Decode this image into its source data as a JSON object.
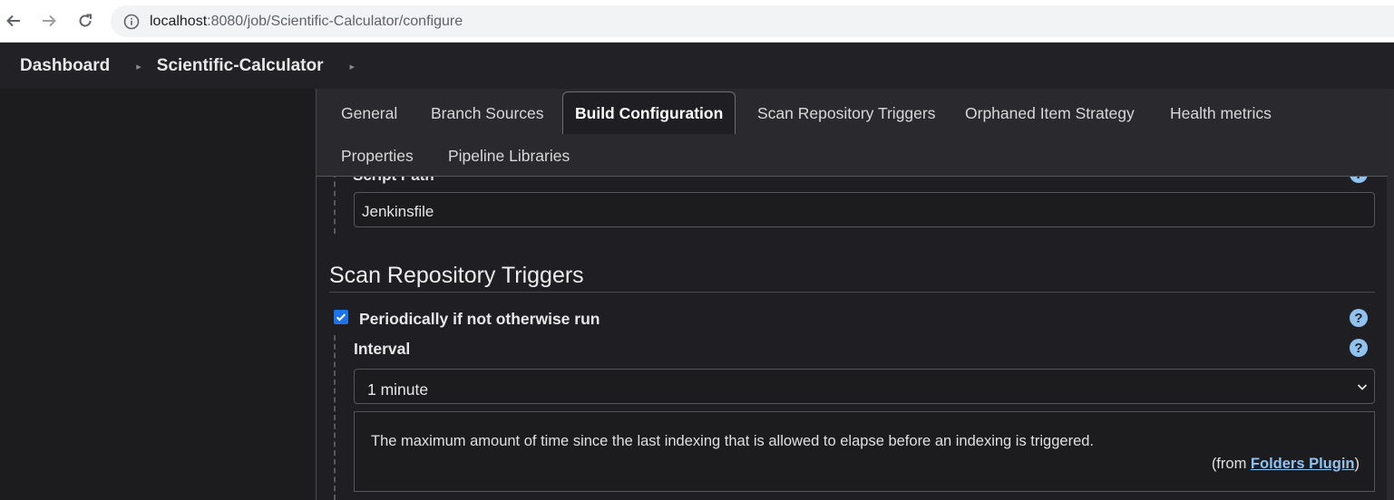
{
  "browser": {
    "url_host": "localhost",
    "url_rest": ":8080/job/Scientific-Calculator/configure"
  },
  "breadcrumb": {
    "items": [
      "Dashboard",
      "Scientific-Calculator"
    ]
  },
  "tabs": [
    {
      "label": "General",
      "active": false
    },
    {
      "label": "Branch Sources",
      "active": false
    },
    {
      "label": "Build Configuration",
      "active": true
    },
    {
      "label": "Scan Repository Triggers",
      "active": false
    },
    {
      "label": "Orphaned Item Strategy",
      "active": false
    },
    {
      "label": "Health metrics",
      "active": false
    },
    {
      "label": "Properties",
      "active": false
    },
    {
      "label": "Pipeline Libraries",
      "active": false
    }
  ],
  "script_path": {
    "label": "Script Path",
    "value": "Jenkinsfile"
  },
  "scan_triggers": {
    "title": "Scan Repository Triggers",
    "periodic_label": "Periodically if not otherwise run",
    "periodic_checked": true,
    "interval_label": "Interval",
    "interval_value": "1 minute",
    "help_text": "The maximum amount of time since the last indexing that is allowed to elapse before an indexing is triggered.",
    "help_from_prefix": "(from ",
    "help_from_link": "Folders Plugin",
    "help_from_suffix": ")"
  },
  "icons": {
    "back": "arrow-left-icon",
    "forward": "arrow-right-icon",
    "reload": "reload-icon",
    "site_info": "info-circle-icon",
    "help": "question-circle-icon",
    "check": "checkmark-icon",
    "chevron": "chevron-down-icon",
    "crumb_sep": "caret-right-icon"
  },
  "colors": {
    "accent": "#8fc2ef",
    "checkbox": "#1a73e8",
    "background": "#1f1f23"
  }
}
